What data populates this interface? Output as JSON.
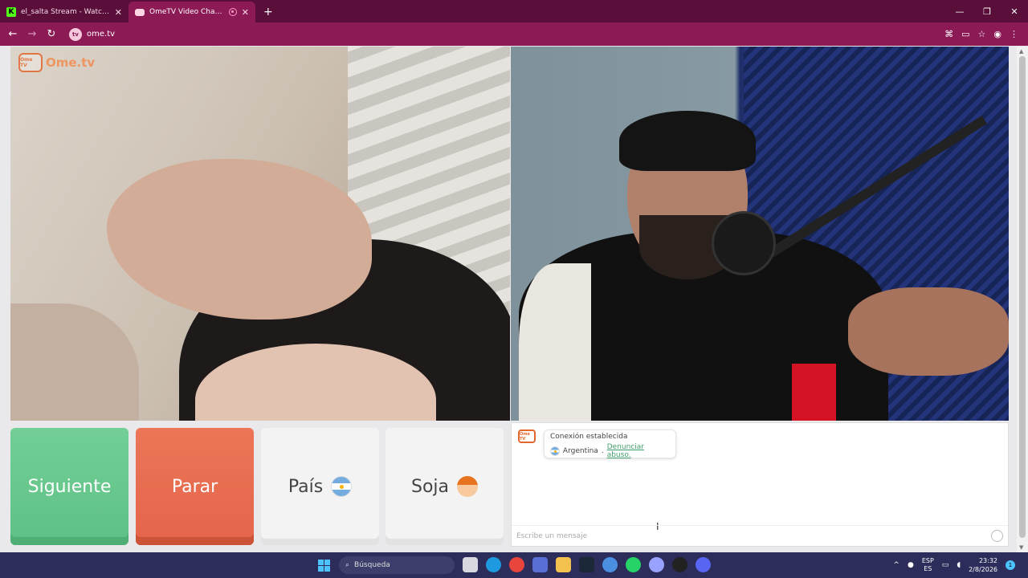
{
  "browser": {
    "tabs": [
      {
        "title": "el_salta Stream - Watch Live on Kick",
        "active": false
      },
      {
        "title": "OmeTV Video Chat — Alternativa",
        "active": true
      }
    ],
    "url": "ome.tv"
  },
  "app": {
    "logo_text": "Ome.tv",
    "logo_badge": "Ome TV"
  },
  "controls": {
    "next_label": "Siguiente",
    "stop_label": "Parar",
    "country_label": "País",
    "gender_label": "Soja"
  },
  "chat": {
    "system_title": "Conexión establecida",
    "country": "Argentina",
    "separator": " . ",
    "report_link": "Denunciar abuso.",
    "input_placeholder": "Escribe un mensaje"
  },
  "taskbar": {
    "search_label": "Búsqueda",
    "lang_top": "ESP",
    "lang_bottom": "ES",
    "time": "23:32",
    "date": "2/8/2026",
    "notif_count": "1"
  },
  "colors": {
    "tabbar": "#5a0f3a",
    "addrbar": "#8c1a55",
    "next_button": "#66c68c",
    "stop_button": "#e86a4e",
    "link": "#3f9e6a",
    "taskbar": "#2c2d5a"
  }
}
